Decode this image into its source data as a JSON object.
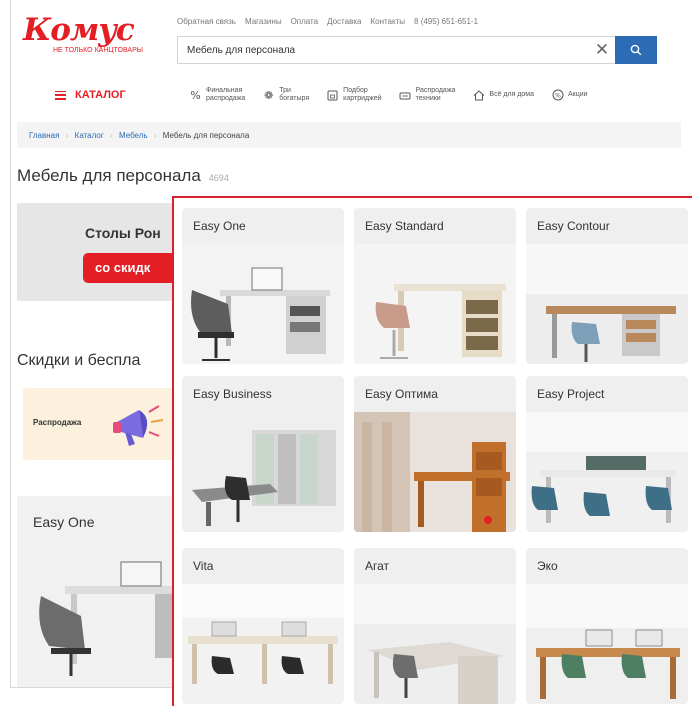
{
  "header": {
    "logo_text": "Комус",
    "logo_tagline": "НЕ ТОЛЬКО КАНЦТОВАРЫ",
    "top_links": [
      "Обратная связь",
      "Магазины",
      "Оплата",
      "Доставка",
      "Контакты",
      "8 (495) 651-651-1"
    ],
    "search": {
      "value": "Мебель для персонала",
      "clear_icon": "close-icon",
      "search_icon": "search-icon"
    },
    "brand_color": "#e31e24",
    "accent_color": "#2b6cb5"
  },
  "nav": {
    "catalog_label": "КАТАЛОГ",
    "items": [
      {
        "label": "Финальная\nраспродажа",
        "icon": "percent-icon"
      },
      {
        "label": "Три\nбогатыря",
        "icon": "gift-icon"
      },
      {
        "label": "Подбор\nкартриджей",
        "icon": "cartridge-icon"
      },
      {
        "label": "Распродажа\nтехники",
        "icon": "printer-icon"
      },
      {
        "label": "Всё для дома",
        "icon": "home-icon"
      },
      {
        "label": "Акции",
        "icon": "discount-icon"
      }
    ]
  },
  "breadcrumb": [
    "Главная",
    "Каталог",
    "Мебель",
    "Мебель для персонала"
  ],
  "page": {
    "title": "Мебель для персонала",
    "count": "4694"
  },
  "banner": {
    "title": "Столы Рон",
    "button_label": "со скидк"
  },
  "discounts": {
    "heading": "Скидки и беспла",
    "promo_label": "Распродажа"
  },
  "background_card": {
    "title": "Easy One"
  },
  "series": [
    {
      "title": "Easy One"
    },
    {
      "title": "Easy Standard"
    },
    {
      "title": "Easy Contour"
    },
    {
      "title": "Easy Business"
    },
    {
      "title": "Easy Оптима"
    },
    {
      "title": "Easy Project"
    },
    {
      "title": "Vita"
    },
    {
      "title": "Агат"
    },
    {
      "title": "Эко"
    }
  ]
}
